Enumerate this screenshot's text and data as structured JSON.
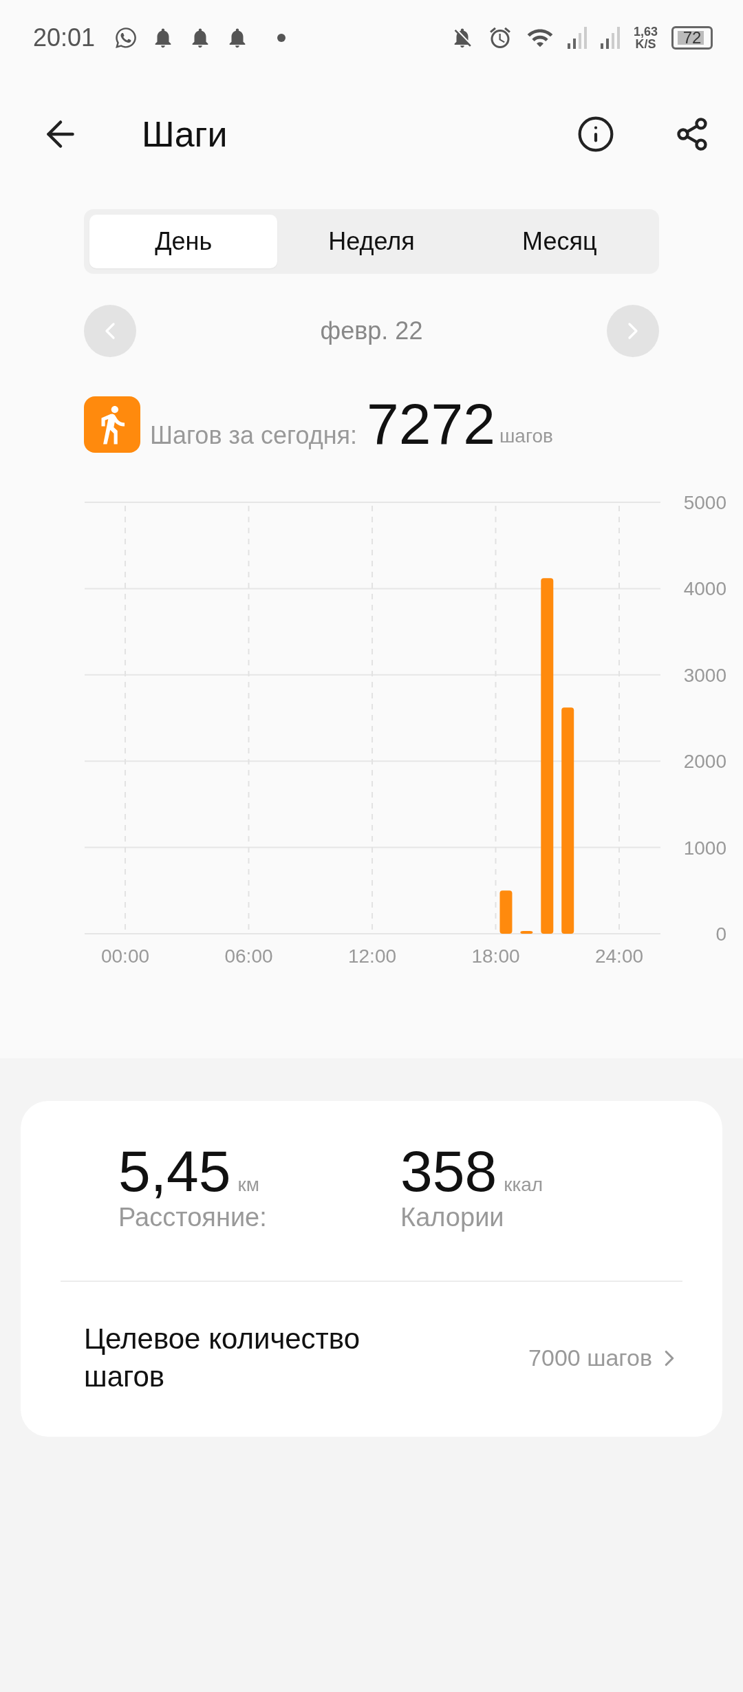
{
  "status_bar": {
    "time": "20:01",
    "speed_value": "1,63",
    "speed_unit": "K/S",
    "battery": "72"
  },
  "header": {
    "title": "Шаги"
  },
  "tabs": [
    {
      "label": "День",
      "selected": true
    },
    {
      "label": "Неделя",
      "selected": false
    },
    {
      "label": "Месяц",
      "selected": false
    }
  ],
  "date_nav": {
    "date": "февр. 22"
  },
  "summary": {
    "label": "Шагов за сегодня:",
    "value": "7272",
    "unit": "шагов"
  },
  "chart_data": {
    "type": "bar",
    "x": [
      18.5,
      19.5,
      20.5,
      21.5
    ],
    "series": [
      {
        "color": "#ff8a0d",
        "values": [
          500,
          30,
          4120,
          2622
        ]
      }
    ],
    "grid": true,
    "xlim": [
      0,
      24
    ],
    "xticks": [
      {
        "value": 0,
        "label": "00:00"
      },
      {
        "value": 6,
        "label": "06:00"
      },
      {
        "value": 12,
        "label": "12:00"
      },
      {
        "value": 18,
        "label": "18:00"
      },
      {
        "value": 24,
        "label": "24:00"
      }
    ],
    "ylim": [
      0,
      5000
    ],
    "yticks": [
      0,
      1000,
      2000,
      3000,
      4000,
      5000
    ]
  },
  "metrics": [
    {
      "value": "5,45",
      "unit": "км",
      "label": "Расстояние:"
    },
    {
      "value": "358",
      "unit": "ккал",
      "label": "Калории"
    }
  ],
  "goal": {
    "label": "Целевое количество шагов",
    "value": "7000 шагов"
  }
}
